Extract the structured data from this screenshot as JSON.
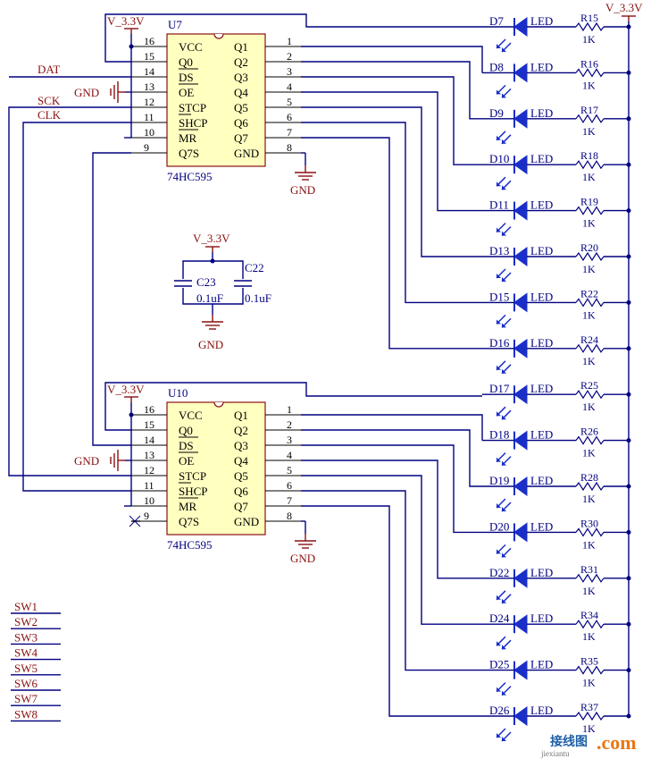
{
  "supply_label": "V_3.3V",
  "ground_label": "GND",
  "chip_part": "74HC595",
  "led_value": "LED",
  "resistor_value": "1K",
  "chips": [
    {
      "designator": "U7",
      "pins_left": [
        {
          "num": "16",
          "name": "VCC"
        },
        {
          "num": "15",
          "name": "Q0"
        },
        {
          "num": "14",
          "name": "DS"
        },
        {
          "num": "13",
          "name": "OE"
        },
        {
          "num": "12",
          "name": "STCP"
        },
        {
          "num": "11",
          "name": "SHCP"
        },
        {
          "num": "10",
          "name": "MR"
        },
        {
          "num": "9",
          "name": "Q7S"
        }
      ],
      "pins_right": [
        {
          "num": "1",
          "name": "Q1"
        },
        {
          "num": "2",
          "name": "Q2"
        },
        {
          "num": "3",
          "name": "Q3"
        },
        {
          "num": "4",
          "name": "Q4"
        },
        {
          "num": "5",
          "name": "Q5"
        },
        {
          "num": "6",
          "name": "Q6"
        },
        {
          "num": "7",
          "name": "Q7"
        },
        {
          "num": "8",
          "name": "GND"
        }
      ]
    },
    {
      "designator": "U10",
      "pins_left": [
        {
          "num": "16",
          "name": "VCC"
        },
        {
          "num": "15",
          "name": "Q0"
        },
        {
          "num": "14",
          "name": "DS"
        },
        {
          "num": "13",
          "name": "OE"
        },
        {
          "num": "12",
          "name": "STCP"
        },
        {
          "num": "11",
          "name": "SHCP"
        },
        {
          "num": "10",
          "name": "MR"
        },
        {
          "num": "9",
          "name": "Q7S"
        }
      ],
      "pins_right": [
        {
          "num": "1",
          "name": "Q1"
        },
        {
          "num": "2",
          "name": "Q2"
        },
        {
          "num": "3",
          "name": "Q3"
        },
        {
          "num": "4",
          "name": "Q4"
        },
        {
          "num": "5",
          "name": "Q5"
        },
        {
          "num": "6",
          "name": "Q6"
        },
        {
          "num": "7",
          "name": "Q7"
        },
        {
          "num": "8",
          "name": "GND"
        }
      ]
    }
  ],
  "net_labels": {
    "dat": "DAT",
    "sck": "SCK",
    "clk": "CLK"
  },
  "capacitors": [
    {
      "designator": "C23",
      "value": "0.1uF"
    },
    {
      "designator": "C22",
      "value": "0.1uF"
    }
  ],
  "leds": [
    "D7",
    "D8",
    "D9",
    "D10",
    "D11",
    "D13",
    "D15",
    "D16",
    "D17",
    "D18",
    "D19",
    "D20",
    "D22",
    "D24",
    "D25",
    "D26"
  ],
  "resistors": [
    "R15",
    "R16",
    "R17",
    "R18",
    "R19",
    "R20",
    "R22",
    "R24",
    "R25",
    "R26",
    "R28",
    "R30",
    "R31",
    "R34",
    "R35",
    "R37"
  ],
  "switches": [
    "SW1",
    "SW2",
    "SW3",
    "SW4",
    "SW5",
    "SW6",
    "SW7",
    "SW8"
  ],
  "watermark": {
    "cn": "接线图",
    "com": ".com",
    "sub": "jiexiantu"
  }
}
